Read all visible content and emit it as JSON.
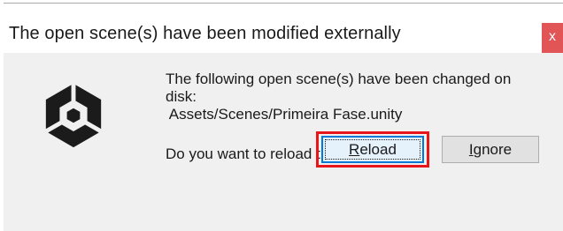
{
  "dialog": {
    "title": "The open scene(s) have been modified externally",
    "close_label": "x",
    "message_lines": [
      "The following open scene(s) have been changed on",
      "disk:",
      " Assets/Scenes/Primeira Fase.unity"
    ],
    "question": "Do you want to reload the scene(s)?",
    "icon": "unity-logo-icon"
  },
  "buttons": {
    "reload": {
      "mnemonic": "R",
      "rest": "eload",
      "highlighted": true,
      "highlight_color": "#e8161b"
    },
    "ignore": {
      "mnemonic": "I",
      "rest": "gnore"
    }
  },
  "colors": {
    "close_button": "#e15557",
    "client_background": "#f0f0f0",
    "default_button_border": "#0078d7"
  }
}
